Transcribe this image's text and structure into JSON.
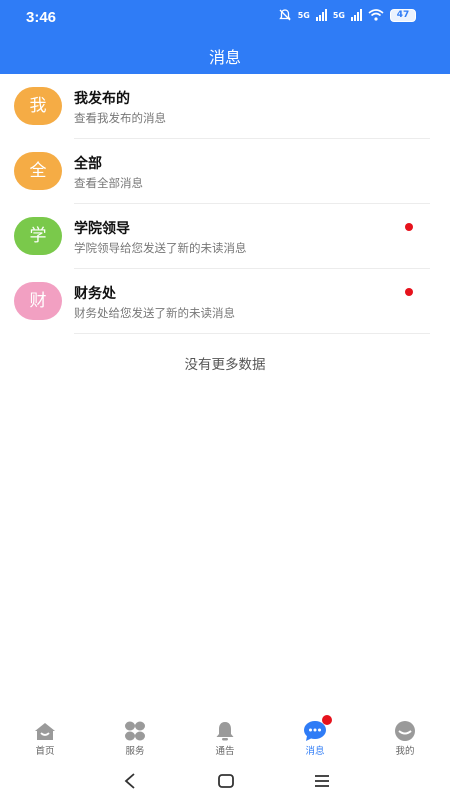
{
  "status_bar": {
    "time": "3:46",
    "network1": "5G",
    "network2": "5G",
    "battery": "47"
  },
  "nav": {
    "title": "消息"
  },
  "messages": [
    {
      "avatar_char": "我",
      "avatar_color": "#f5ac45",
      "title": "我发布的",
      "subtitle": "查看我发布的消息",
      "unread": false
    },
    {
      "avatar_char": "全",
      "avatar_color": "#f5ac45",
      "title": "全部",
      "subtitle": "查看全部消息",
      "unread": false
    },
    {
      "avatar_char": "学",
      "avatar_color": "#7ac94b",
      "title": "学院领导",
      "subtitle": "学院领导给您发送了新的未读消息",
      "unread": true
    },
    {
      "avatar_char": "财",
      "avatar_color": "#f2a0c2",
      "title": "财务处",
      "subtitle": "财务处给您发送了新的未读消息",
      "unread": true
    }
  ],
  "no_more_text": "没有更多数据",
  "tabbar": {
    "items": [
      {
        "label": "首页",
        "icon": "home-icon",
        "active": false
      },
      {
        "label": "服务",
        "icon": "services-grid-icon",
        "active": false
      },
      {
        "label": "通告",
        "icon": "bell-icon",
        "active": false
      },
      {
        "label": "消息",
        "icon": "chat-bubble-icon",
        "active": true,
        "badge": true
      },
      {
        "label": "我的",
        "icon": "profile-face-icon",
        "active": false
      }
    ],
    "active_color": "#2f7cf6",
    "inactive_color": "#999999"
  },
  "colors": {
    "brand": "#2f7cf6",
    "unread_dot": "#e6121c"
  }
}
